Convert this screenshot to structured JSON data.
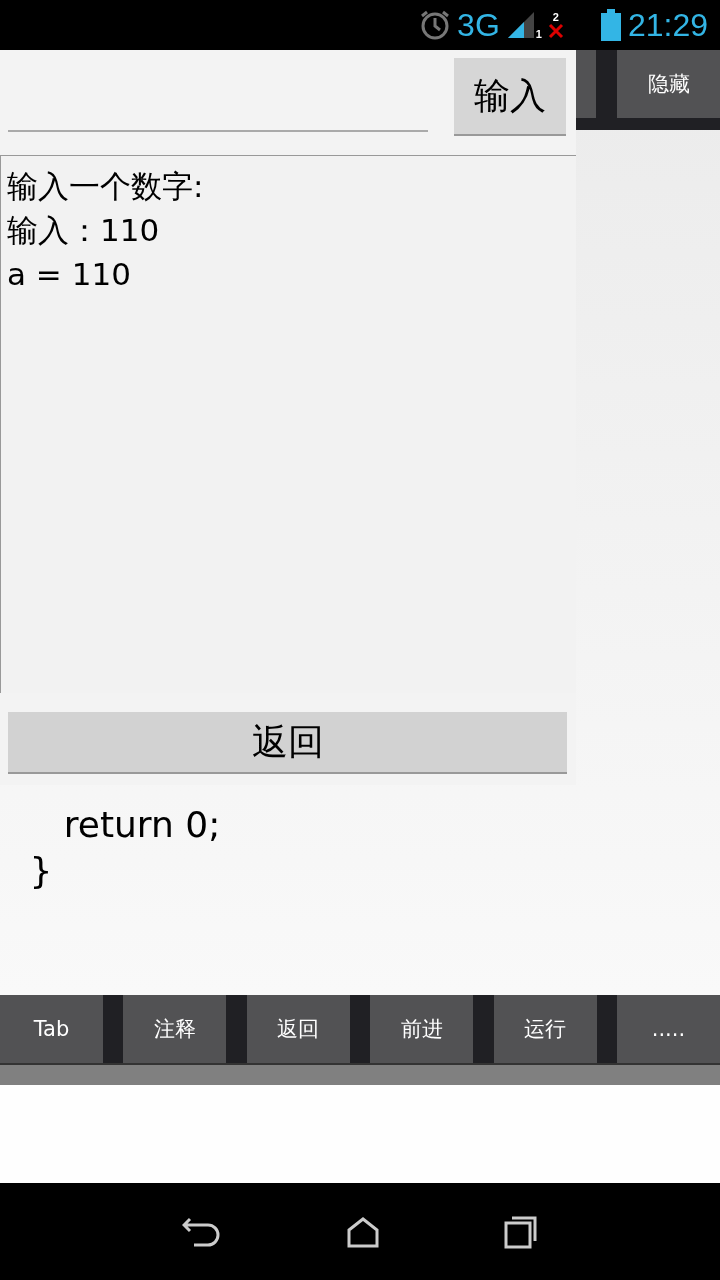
{
  "status_bar": {
    "network": "3G",
    "sim_1": "1",
    "sim_2": "2",
    "time": "21:29"
  },
  "top_toolbar": {
    "buttons": [
      "隐藏"
    ]
  },
  "dialog": {
    "input_button": "输入",
    "output_lines": [
      "输入一个数字:",
      "输入：110",
      "a = 110"
    ],
    "back_button": "返回"
  },
  "editor": {
    "lines": [
      "    return 0;",
      " }"
    ]
  },
  "bottom_toolbar": {
    "buttons": [
      "Tab",
      "注释",
      "返回",
      "前进",
      "运行",
      "....."
    ]
  }
}
